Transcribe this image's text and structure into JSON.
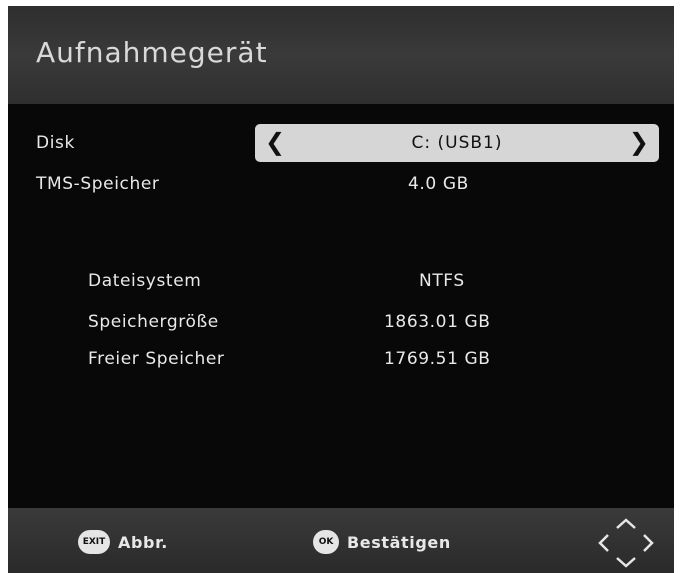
{
  "header": {
    "title": "Aufnahmegerät"
  },
  "settings": {
    "disk": {
      "label": "Disk",
      "value": "C: (USB1)"
    },
    "tms": {
      "label": "TMS-Speicher",
      "value": "4.0 GB"
    }
  },
  "info": {
    "filesystem": {
      "label": "Dateisystem",
      "value": "NTFS"
    },
    "size": {
      "label": "Speichergröße",
      "value": "1863.01 GB"
    },
    "free": {
      "label": "Freier Speicher",
      "value": "1769.51 GB"
    }
  },
  "footer": {
    "exit": {
      "key": "EXIT",
      "label": "Abbr."
    },
    "ok": {
      "key": "OK",
      "label": "Bestätigen"
    }
  },
  "icons": {
    "exit_key": "exit-key-icon",
    "ok_key": "ok-key-icon",
    "navigation": "directional-arrows-icon",
    "left": "chevron-left-icon",
    "right": "chevron-right-icon"
  }
}
